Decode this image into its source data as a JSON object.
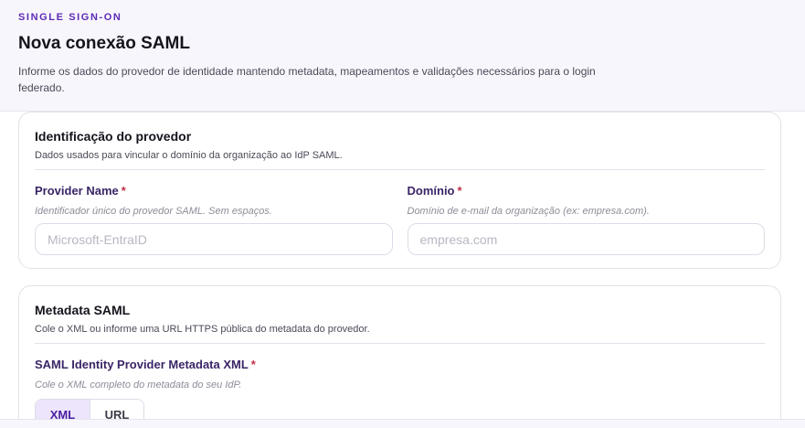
{
  "header": {
    "eyebrow": "SINGLE SIGN-ON",
    "title": "Nova conexão SAML",
    "description": "Informe os dados do provedor de identidade mantendo metadata, mapeamentos e validações necessários para o login federado."
  },
  "provider_section": {
    "title": "Identificação do provedor",
    "subtitle": "Dados usados para vincular o domínio da organização ao IdP SAML.",
    "provider_name": {
      "label": "Provider Name",
      "required_mark": "*",
      "hint": "Identificador único do provedor SAML. Sem espaços.",
      "placeholder": "Microsoft-EntraID",
      "value": ""
    },
    "domain": {
      "label": "Domínio",
      "required_mark": "*",
      "hint": "Domínio de e-mail da organização (ex: empresa.com).",
      "placeholder": "empresa.com",
      "value": ""
    }
  },
  "metadata_section": {
    "title": "Metadata SAML",
    "subtitle": "Cole o XML ou informe uma URL HTTPS pública do metadata do provedor.",
    "metadata_field": {
      "label": "SAML Identity Provider Metadata XML",
      "required_mark": "*",
      "hint": "Cole o XML completo do metadata do seu IdP."
    },
    "tabs": [
      {
        "label": "XML",
        "active": true
      },
      {
        "label": "URL",
        "active": false
      }
    ]
  },
  "colors": {
    "accent": "#5b2bb4",
    "label": "#3a2566",
    "required": "#c0304a",
    "tab_active_bg": "#ede5fb",
    "header_bg": "#f8f6fd"
  }
}
